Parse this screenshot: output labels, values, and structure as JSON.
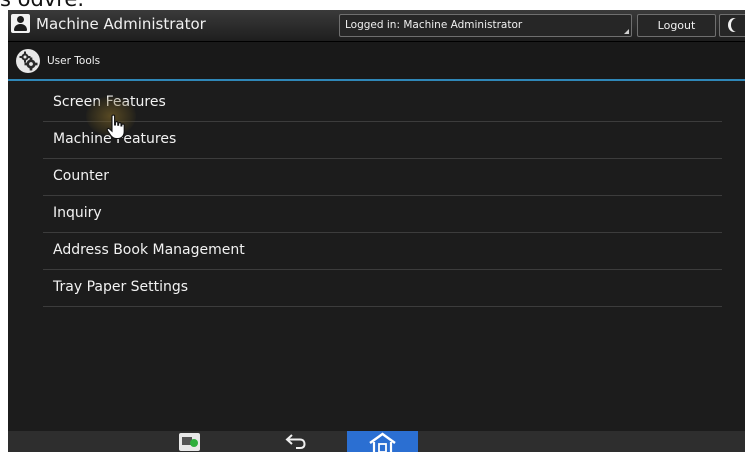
{
  "page": {
    "caption_fragment": "s odvre."
  },
  "status_bar": {
    "user_name": "Machine Administrator",
    "login_status": "Logged in: Machine Administrator",
    "logout_label": "Logout",
    "icons": [
      "user-icon",
      "energy-saver-moon-icon"
    ]
  },
  "title_bar": {
    "title": "User Tools",
    "icon": "gear-tools-icon",
    "accent_color": "#2f87b8"
  },
  "menu": {
    "items": [
      {
        "label": "Screen Features"
      },
      {
        "label": "Machine Features"
      },
      {
        "label": "Counter"
      },
      {
        "label": "Inquiry"
      },
      {
        "label": "Address Book Management"
      },
      {
        "label": "Tray Paper Settings"
      }
    ]
  },
  "bottom_bar": {
    "icons": [
      "app-status-icon",
      "back-arrow-icon",
      "home-icon"
    ],
    "home_color": "#2b6fd2"
  },
  "colors": {
    "panel_background": "#1c1c1c",
    "text": "#f2f2f2",
    "divider": "#3c3c3c"
  }
}
